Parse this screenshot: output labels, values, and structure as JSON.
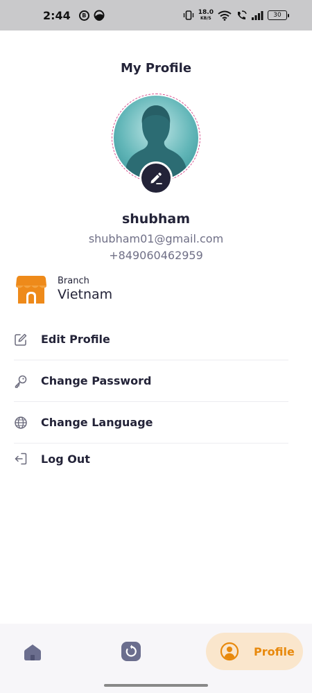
{
  "status_bar": {
    "time": "2:44",
    "notification_icons": [
      "b-circle-icon",
      "half-moon-icon"
    ],
    "net_speed_value": "18.0",
    "net_speed_unit": "KB/S",
    "battery": "30"
  },
  "header": {
    "title": "My Profile"
  },
  "profile": {
    "name": "shubham",
    "email": "shubham01@gmail.com",
    "phone": "+849060462959"
  },
  "branch": {
    "label": "Branch",
    "value": "Vietnam"
  },
  "menu": {
    "items": [
      {
        "label": "Edit Profile",
        "icon": "edit-icon"
      },
      {
        "label": "Change Password",
        "icon": "key-icon"
      },
      {
        "label": "Change Language",
        "icon": "globe-icon"
      },
      {
        "label": "Log Out",
        "icon": "logout-icon"
      }
    ]
  },
  "bottom_nav": {
    "active_label": "Profile",
    "items": [
      "home-icon",
      "history-icon",
      "profile-icon"
    ]
  },
  "colors": {
    "accent": "#e8890c",
    "accent_soft": "#fae6cc",
    "dark": "#232338",
    "muted": "#6f6f86",
    "avatar_teal": "#62b6b8"
  }
}
